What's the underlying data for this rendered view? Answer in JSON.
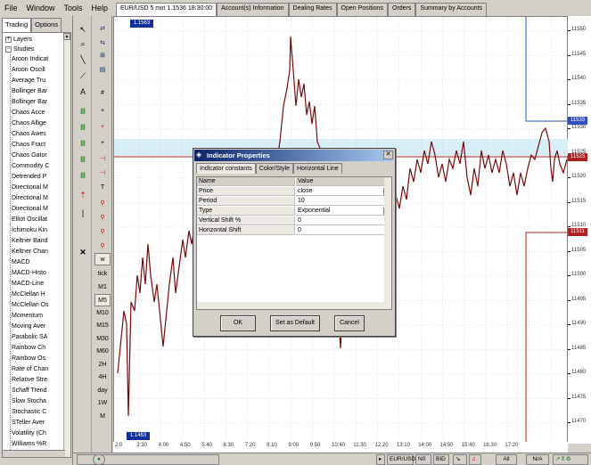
{
  "menu": [
    "File",
    "Window",
    "Tools",
    "Help"
  ],
  "tabs": [
    "EUR/USD 5 min 1.1536 18:30:00",
    "Account(s) Information",
    "Dealing Rates",
    "Open Positions",
    "Orders",
    "Summary by Accounts"
  ],
  "left_tabs": [
    "Trading",
    "Options"
  ],
  "tree": {
    "layers_label": "Layers",
    "studies_label": "Studies",
    "items": [
      "Aroon Indicat",
      "Aroon Oscill",
      "Average Tru",
      "Bollinger Bar",
      "Bollinger Bar",
      "Chaos Acce",
      "Chaos Allige",
      "Chaos Awes",
      "Chaos Fract",
      "Chaos Gator",
      "Commodity C",
      "Detrended P",
      "Directional M",
      "Directional M",
      "Directional M",
      "Elliot Oscillat",
      "Ichimoku Kin",
      "Keltner Band",
      "Keltner Chan",
      "MACD",
      "MACD-Histo",
      "MACD-Line",
      "McClellan H",
      "McClellan Os",
      "Momentum",
      "Moving Aver",
      "Parabolic SA",
      "Rainbow Ch",
      "Rainbow Os",
      "Rate of Chan",
      "Relative Stre",
      "Schaff Trend",
      "Slow Stocha",
      "Stochastic C",
      "STeller Aver",
      "Volatility (Ch",
      "Williams %R"
    ]
  },
  "timeframes": [
    "tick",
    "M1",
    "M5",
    "M10",
    "M15",
    "M30",
    "M60",
    "2H",
    "4H",
    "day",
    "1W",
    "M"
  ],
  "price_labels": [
    "11550",
    "11545",
    "11540",
    "11535",
    "11530",
    "11525",
    "11520",
    "11515",
    "11510",
    "11505",
    "11500",
    "11495",
    "11490",
    "11485",
    "11480",
    "11475",
    "11470"
  ],
  "time_labels": [
    "2:0",
    "3:30",
    "4:00",
    "4:50",
    "5:40",
    "6:30",
    "7:20",
    "8:10",
    "9:00",
    "9:50",
    "10:40",
    "11:30",
    "12:20",
    "13:10",
    "14:00",
    "14:50",
    "15:40",
    "16:30",
    "17:20"
  ],
  "chart": {
    "high_tag": "1.1563",
    "low_tag": "1.1463",
    "ask_tag": "11533",
    "bid_tag": "11523",
    "cur_tag": "11511"
  },
  "colors": {
    "price_line": "#7a0a0a",
    "ask_line": "#3050c0",
    "bid_line": "#b02020",
    "highlight_band": "#d8eef8"
  },
  "dialog": {
    "title": "Indicator Properties",
    "tabs": [
      "Indicator constants",
      "Color/Style",
      "Horizontal Line"
    ],
    "header": {
      "name": "Name",
      "value": "Value"
    },
    "rows": [
      {
        "name": "Price",
        "value": "close"
      },
      {
        "name": "Period",
        "value": "10"
      },
      {
        "name": "Type",
        "value": "Exponential"
      },
      {
        "name": "Vertical Shift %",
        "value": "0"
      },
      {
        "name": "Horizontal Shift",
        "value": "0"
      }
    ],
    "buttons": {
      "ok": "OK",
      "default": "Set as Default",
      "cancel": "Cancel"
    }
  },
  "statusbar": {
    "symbol": "EUR/USD",
    "n0": "N0",
    "bid": "BID",
    "all": "All",
    "na": "N/A"
  }
}
